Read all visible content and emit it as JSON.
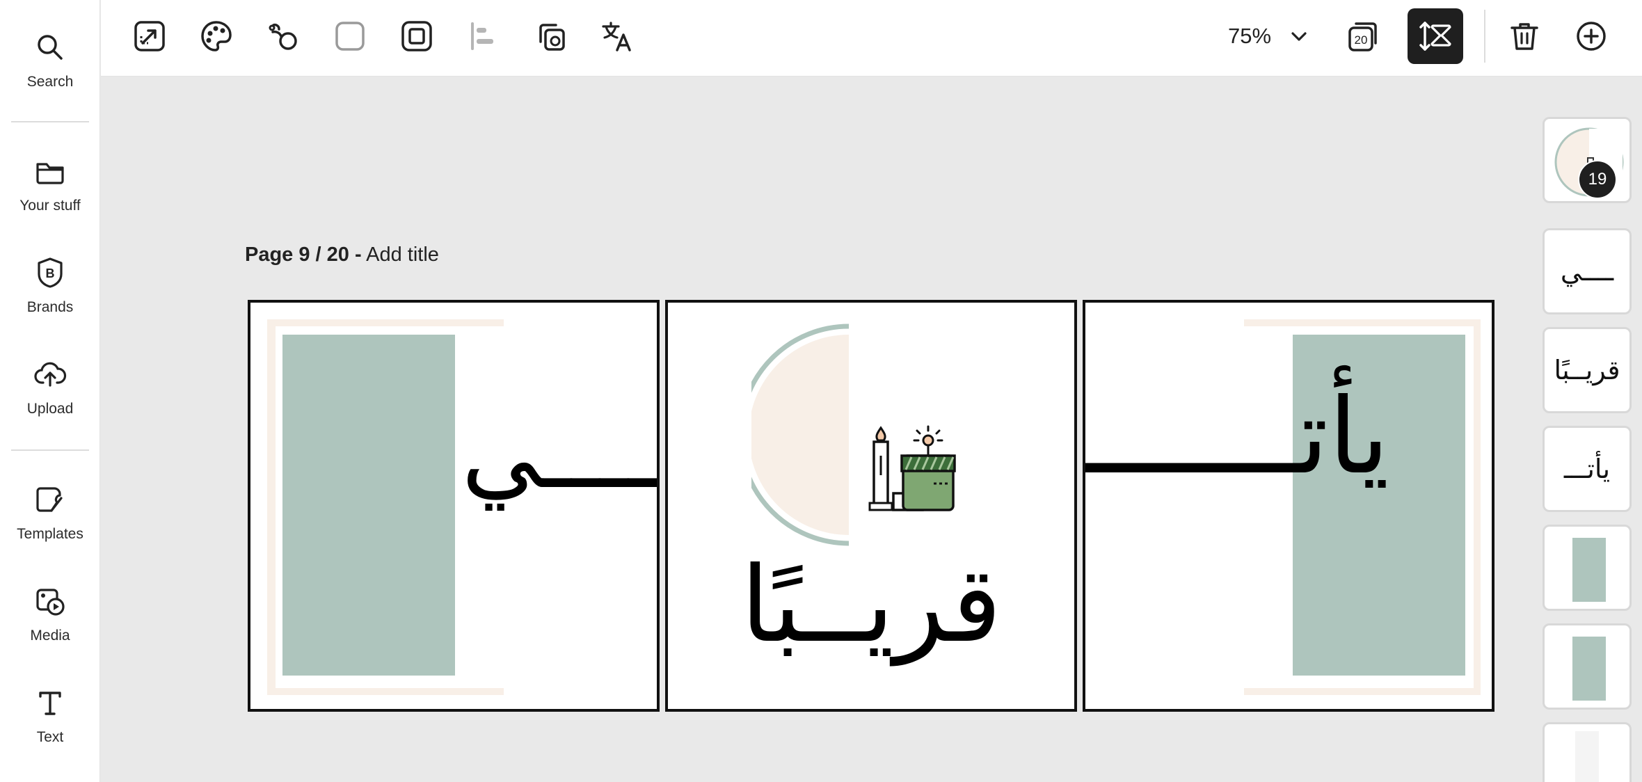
{
  "sidebar": {
    "items": [
      {
        "label": "Search",
        "icon": "search-icon"
      },
      {
        "label": "Your stuff",
        "icon": "folder-icon"
      },
      {
        "label": "Brands",
        "icon": "brand-icon"
      },
      {
        "label": "Upload",
        "icon": "upload-icon"
      },
      {
        "label": "Templates",
        "icon": "templates-icon"
      },
      {
        "label": "Media",
        "icon": "media-icon"
      },
      {
        "label": "Text",
        "icon": "text-icon"
      }
    ]
  },
  "toolbar": {
    "tools": [
      "resize-icon",
      "palette-icon",
      "animate-icon",
      "corner-icon",
      "border-icon",
      "align-icon",
      "duplicate-icon",
      "translate-icon"
    ],
    "zoom": "75%",
    "pages_count_icon_label": "20",
    "right_tools": [
      "pages-icon",
      "layout-icon",
      "trash-icon",
      "add-icon"
    ]
  },
  "page": {
    "label": "Page 9 / 20",
    "separator": "-",
    "title_placeholder": "Add title"
  },
  "canvas": {
    "panel1_text": "ــــي",
    "panel2_text": "قريــبًا",
    "panel3_text": "يأتـــــــ",
    "colors": {
      "sage": "#aec5bd",
      "cream": "#f8efe7",
      "green_icon": "#7fa772",
      "border": "#111111"
    }
  },
  "thumbnails": {
    "badge": "19",
    "items": [
      {
        "text": ""
      },
      {
        "text": "ــــي"
      },
      {
        "text": "قريــبًا"
      },
      {
        "text": "يأتـــ"
      },
      {
        "text": ""
      },
      {
        "text": ""
      },
      {
        "text": ""
      }
    ]
  }
}
